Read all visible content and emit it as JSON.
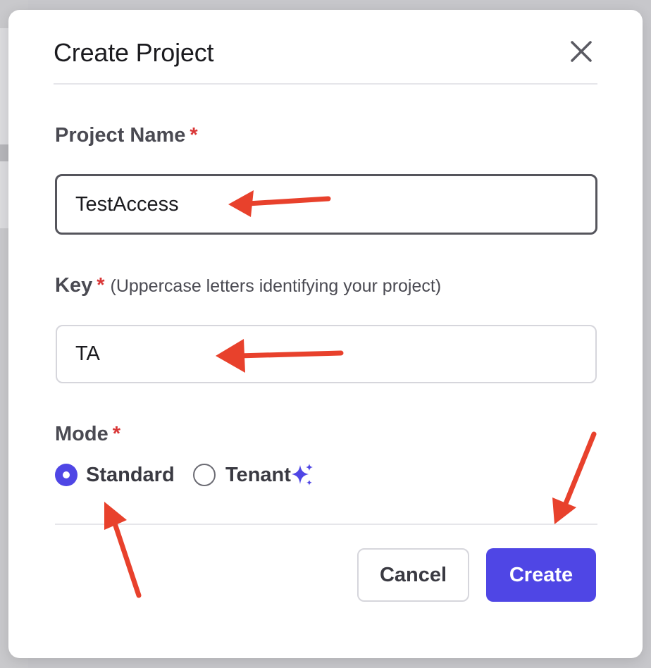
{
  "dialog": {
    "title": "Create Project",
    "close_icon": "close-icon"
  },
  "project_name": {
    "label": "Project Name",
    "required_marker": "*",
    "value": "TestAccess"
  },
  "key": {
    "label": "Key",
    "required_marker": "*",
    "hint": "(Uppercase letters identifying your project)",
    "value": "TA"
  },
  "mode": {
    "label": "Mode",
    "required_marker": "*",
    "options": [
      {
        "label": "Standard",
        "selected": true
      },
      {
        "label": "Tenant",
        "selected": false,
        "icon": "sparkle-icon"
      }
    ]
  },
  "footer": {
    "cancel_label": "Cancel",
    "create_label": "Create"
  },
  "colors": {
    "accent": "#4f46e5",
    "required": "#d93636",
    "annotation_arrow": "#e8412c"
  }
}
